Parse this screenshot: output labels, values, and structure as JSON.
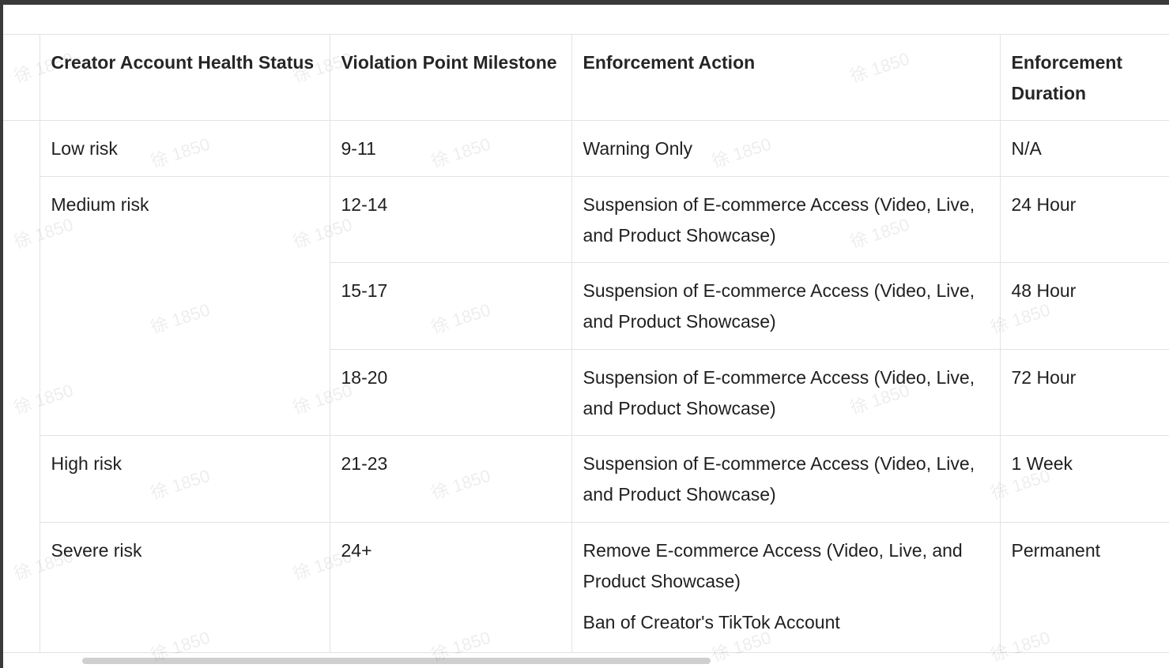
{
  "table": {
    "headers": [
      "Creator Account Health Status",
      "Violation Point Milestone",
      "Enforcement Action",
      "Enforcement Duration"
    ],
    "rows": [
      {
        "status": "Low risk",
        "milestone": "9-11",
        "action": "Warning Only",
        "duration": "N/A"
      },
      {
        "status": "Medium risk",
        "milestone": "12-14",
        "action": "Suspension of E-commerce Access (Video, Live, and Product Showcase)",
        "duration": "24 Hour"
      },
      {
        "milestone": "15-17",
        "action": "Suspension of E-commerce Access (Video, Live, and Product Showcase)",
        "duration": "48 Hour"
      },
      {
        "milestone": "18-20",
        "action": "Suspension of E-commerce Access (Video, Live, and Product Showcase)",
        "duration": "72 Hour"
      },
      {
        "status": "High risk",
        "milestone": "21-23",
        "action": "Suspension of E-commerce Access (Video, Live, and Product Showcase)",
        "duration": "1 Week"
      },
      {
        "status": "Severe risk",
        "milestone": "24+",
        "action": "Remove E-commerce Access (Video, Live, and Product Showcase)",
        "action_extra": "Ban of Creator's TikTok Account",
        "duration": "Permanent"
      }
    ]
  },
  "watermark": "徐 1850"
}
